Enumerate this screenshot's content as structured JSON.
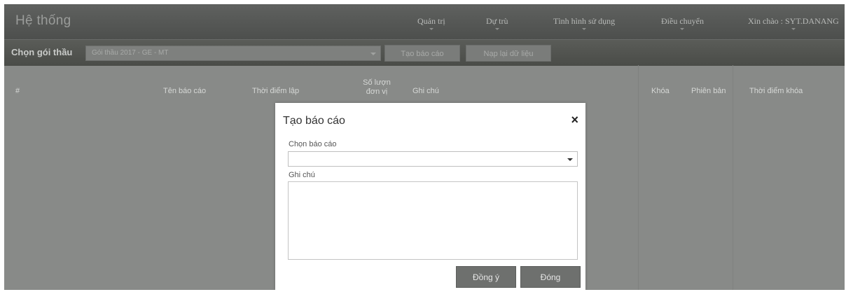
{
  "navbar": {
    "brand": "Hệ thống",
    "items": [
      "Quản trị",
      "Dự trù",
      "Tình hình sử dụng",
      "Điều chuyển"
    ],
    "greeting": "Xin chào : SYT.DANANG"
  },
  "toolbar": {
    "package_label": "Chọn gói thầu",
    "package_value": "Gói thầu 2017 - GE - MT",
    "create_report": "Tạo báo cáo",
    "reload_data": "Nạp lại dữ liệu"
  },
  "table": {
    "headers": {
      "index": "#",
      "report_name": "Tên báo cáo",
      "created_time": "Thời điểm lập",
      "unit_count_1": "Số lượn",
      "unit_count_2": "đơn vị",
      "note": "Ghi chú",
      "lock": "Khóa",
      "version": "Phiên bản",
      "lock_time": "Thời điểm khóa"
    }
  },
  "modal": {
    "title": "Tạo báo cáo",
    "close_symbol": "×",
    "select_label": "Chọn báo cáo",
    "select_value": "",
    "note_label": "Ghi chú",
    "note_value": "",
    "confirm": "Đồng ý",
    "close": "Đóng"
  },
  "colors": {
    "overlay": "#888a88",
    "navbar": "#545654",
    "modal_bg": "#ffffff",
    "modal_button": "#6e706e"
  },
  "icons": {
    "close": "close-icon",
    "dropdown": "chevron-down-icon"
  }
}
